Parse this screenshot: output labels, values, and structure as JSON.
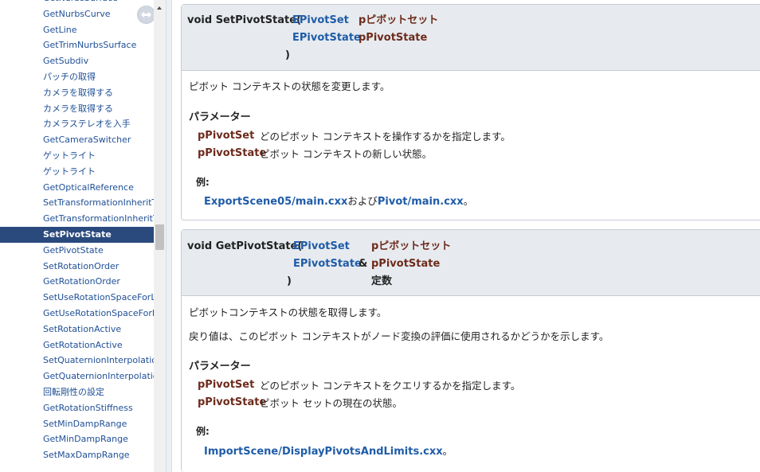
{
  "nav": {
    "items": [
      "GetNurbsSurface",
      "GetNurbsCurve",
      "GetLine",
      "GetTrimNurbsSurface",
      "GetSubdiv",
      "パッチの取得",
      "カメラを取得する",
      "カメラを取得する",
      "カメラステレオを入手",
      "GetCameraSwitcher",
      "ゲットライト",
      "ゲットライト",
      "GetOpticalReference",
      "SetTransformationInheritType",
      "GetTransformationInheritType",
      "SetPivotState",
      "GetPivotState",
      "SetRotationOrder",
      "GetRotationOrder",
      "SetUseRotationSpaceForLimitOnly",
      "GetUseRotationSpaceForLimitOnly",
      "SetRotationActive",
      "GetRotationActive",
      "SetQuaternionInterpolation",
      "GetQuaternionInterpolation",
      "回転剛性の設定",
      "GetRotationStiffness",
      "SetMinDampRange",
      "GetMinDampRange",
      "SetMaxDampRange"
    ],
    "selected": "SetPivotState"
  },
  "cards": {
    "set": {
      "sig": {
        "prefix": "void SetPivotState(",
        "t1": "EPivotSet",
        "p1": "pピボットセット",
        "t2": "EPivotState",
        "p2": "pPivotState",
        "close": ")"
      },
      "desc": "ピボット コンテキストの状態を変更します。",
      "params_heading": "パラメーター",
      "params": [
        {
          "name": "pPivotSet",
          "desc": "どのピボット コンテキストを操作するかを指定します。"
        },
        {
          "name": "pPivotState",
          "desc": "ピボット コンテキストの新しい状態。"
        }
      ],
      "example_label": "例:",
      "example": {
        "link1": "ExportScene05/main.cxx",
        "mid": "および",
        "link2": "Pivot/main.cxx",
        "end": "。"
      }
    },
    "get": {
      "sig": {
        "prefix": "void GetPivotState(",
        "t1": "EPivotSet",
        "p1": "pピボットセット",
        "t2": "EPivotState",
        "amp": "&",
        "p2": "pPivotState",
        "close": ")",
        "qual": "定数"
      },
      "desc1": "ピボットコンテキストの状態を取得します。",
      "desc2": "戻り値は、このピボット コンテキストがノード変換の評価に使用されるかどうかを示します。",
      "params_heading": "パラメーター",
      "params": [
        {
          "name": "pPivotSet",
          "desc": "どのピボット コンテキストをクエリするかを指定します。"
        },
        {
          "name": "pPivotState",
          "desc": "ピボット セットの現在の状態。"
        }
      ],
      "example_label": "例:",
      "example": {
        "link1": "ImportScene/DisplayPivotsAndLimits.cxx",
        "end": "。"
      }
    }
  },
  "colors": {
    "link": "#1f5ca8",
    "param": "#6e2b1c",
    "selected_bg": "#2a4a7e",
    "header_bg": "#e7ebef"
  }
}
